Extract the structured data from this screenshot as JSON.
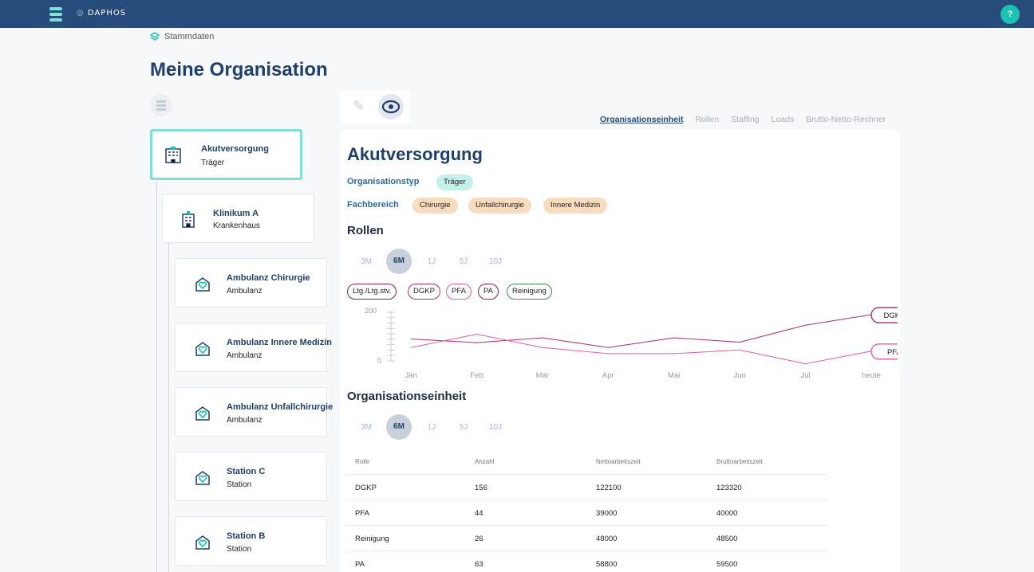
{
  "app": {
    "logo": "DAPHOS",
    "help": "?"
  },
  "breadcrumb": "Stammdaten",
  "page_title": "Meine Organisation",
  "tabs": [
    "Organisationseinheit",
    "Rollen",
    "Staffing",
    "Loads",
    "Brutto-Netto-Rechner"
  ],
  "tree": [
    {
      "title": "Akutversorgung",
      "subtitle": "Träger"
    },
    {
      "title": "Klinikum A",
      "subtitle": "Krankenhaus"
    },
    {
      "title": "Ambulanz Chirurgie",
      "subtitle": "Ambulanz"
    },
    {
      "title": "Ambulanz Innere Medizin",
      "subtitle": "Ambulanz"
    },
    {
      "title": "Ambulanz Unfallchirurgie",
      "subtitle": "Ambulanz"
    },
    {
      "title": "Station C",
      "subtitle": "Station"
    },
    {
      "title": "Station B",
      "subtitle": "Station"
    }
  ],
  "detail": {
    "title": "Akutversorgung",
    "orgtype_label": "Organisationstyp",
    "orgtype": "Träger",
    "fach_label": "Fachbereich",
    "fach": [
      "Chirurgie",
      "Unfallchirurgie",
      "Innere Medizin"
    ],
    "roles_title": "Rollen",
    "ranges": [
      "3M",
      "6M",
      "1J",
      "5J",
      "10J"
    ],
    "legend": [
      "Ltg./Ltg.stv.",
      "DGKP",
      "PFA",
      "PA",
      "Reinigung"
    ],
    "oe_title": "Organisationseinheit"
  },
  "colors": {
    "accent": "#19c3b4",
    "navy": "#274b7a",
    "dgkp": "#a52b7c",
    "pfa": "#e85aa9",
    "pa": "#8b1d4e",
    "ltg": "#8b1d4e",
    "rein": "#3a8f52"
  },
  "chart_data": {
    "type": "line",
    "categories": [
      "Jän",
      "Feb",
      "Mär",
      "Apr",
      "Mai",
      "Jun",
      "Jul",
      "heute"
    ],
    "y_ticks": [
      "200",
      "0"
    ],
    "ylim": [
      0,
      200
    ],
    "series": [
      {
        "name": "DGKP",
        "values": [
          90,
          75,
          95,
          55,
          95,
          77,
          147,
          190
        ]
      },
      {
        "name": "PFA",
        "values": [
          55,
          110,
          55,
          30,
          30,
          45,
          -12,
          40
        ]
      }
    ]
  },
  "table": {
    "headers": [
      "Rolle",
      "Anzahl",
      "Nettoarbeitszeit",
      "Bruttoarbeitszeit"
    ],
    "rows": [
      [
        "DGKP",
        "156",
        "122100",
        "123320"
      ],
      [
        "PFA",
        "44",
        "39000",
        "40000"
      ],
      [
        "Reinigung",
        "26",
        "48000",
        "48500"
      ],
      [
        "PA",
        "63",
        "58800",
        "59500"
      ]
    ]
  }
}
